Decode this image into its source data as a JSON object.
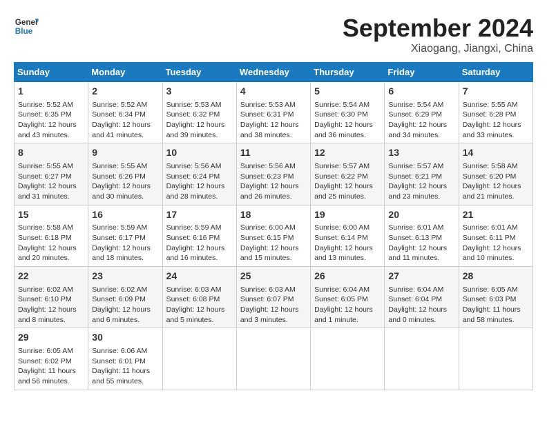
{
  "logo": {
    "line1": "General",
    "line2": "Blue"
  },
  "title": "September 2024",
  "subtitle": "Xiaogang, Jiangxi, China",
  "weekdays": [
    "Sunday",
    "Monday",
    "Tuesday",
    "Wednesday",
    "Thursday",
    "Friday",
    "Saturday"
  ],
  "weeks": [
    [
      {
        "day": "1",
        "info": "Sunrise: 5:52 AM\nSunset: 6:35 PM\nDaylight: 12 hours\nand 43 minutes."
      },
      {
        "day": "2",
        "info": "Sunrise: 5:52 AM\nSunset: 6:34 PM\nDaylight: 12 hours\nand 41 minutes."
      },
      {
        "day": "3",
        "info": "Sunrise: 5:53 AM\nSunset: 6:32 PM\nDaylight: 12 hours\nand 39 minutes."
      },
      {
        "day": "4",
        "info": "Sunrise: 5:53 AM\nSunset: 6:31 PM\nDaylight: 12 hours\nand 38 minutes."
      },
      {
        "day": "5",
        "info": "Sunrise: 5:54 AM\nSunset: 6:30 PM\nDaylight: 12 hours\nand 36 minutes."
      },
      {
        "day": "6",
        "info": "Sunrise: 5:54 AM\nSunset: 6:29 PM\nDaylight: 12 hours\nand 34 minutes."
      },
      {
        "day": "7",
        "info": "Sunrise: 5:55 AM\nSunset: 6:28 PM\nDaylight: 12 hours\nand 33 minutes."
      }
    ],
    [
      {
        "day": "8",
        "info": "Sunrise: 5:55 AM\nSunset: 6:27 PM\nDaylight: 12 hours\nand 31 minutes."
      },
      {
        "day": "9",
        "info": "Sunrise: 5:55 AM\nSunset: 6:26 PM\nDaylight: 12 hours\nand 30 minutes."
      },
      {
        "day": "10",
        "info": "Sunrise: 5:56 AM\nSunset: 6:24 PM\nDaylight: 12 hours\nand 28 minutes."
      },
      {
        "day": "11",
        "info": "Sunrise: 5:56 AM\nSunset: 6:23 PM\nDaylight: 12 hours\nand 26 minutes."
      },
      {
        "day": "12",
        "info": "Sunrise: 5:57 AM\nSunset: 6:22 PM\nDaylight: 12 hours\nand 25 minutes."
      },
      {
        "day": "13",
        "info": "Sunrise: 5:57 AM\nSunset: 6:21 PM\nDaylight: 12 hours\nand 23 minutes."
      },
      {
        "day": "14",
        "info": "Sunrise: 5:58 AM\nSunset: 6:20 PM\nDaylight: 12 hours\nand 21 minutes."
      }
    ],
    [
      {
        "day": "15",
        "info": "Sunrise: 5:58 AM\nSunset: 6:18 PM\nDaylight: 12 hours\nand 20 minutes."
      },
      {
        "day": "16",
        "info": "Sunrise: 5:59 AM\nSunset: 6:17 PM\nDaylight: 12 hours\nand 18 minutes."
      },
      {
        "day": "17",
        "info": "Sunrise: 5:59 AM\nSunset: 6:16 PM\nDaylight: 12 hours\nand 16 minutes."
      },
      {
        "day": "18",
        "info": "Sunrise: 6:00 AM\nSunset: 6:15 PM\nDaylight: 12 hours\nand 15 minutes."
      },
      {
        "day": "19",
        "info": "Sunrise: 6:00 AM\nSunset: 6:14 PM\nDaylight: 12 hours\nand 13 minutes."
      },
      {
        "day": "20",
        "info": "Sunrise: 6:01 AM\nSunset: 6:13 PM\nDaylight: 12 hours\nand 11 minutes."
      },
      {
        "day": "21",
        "info": "Sunrise: 6:01 AM\nSunset: 6:11 PM\nDaylight: 12 hours\nand 10 minutes."
      }
    ],
    [
      {
        "day": "22",
        "info": "Sunrise: 6:02 AM\nSunset: 6:10 PM\nDaylight: 12 hours\nand 8 minutes."
      },
      {
        "day": "23",
        "info": "Sunrise: 6:02 AM\nSunset: 6:09 PM\nDaylight: 12 hours\nand 6 minutes."
      },
      {
        "day": "24",
        "info": "Sunrise: 6:03 AM\nSunset: 6:08 PM\nDaylight: 12 hours\nand 5 minutes."
      },
      {
        "day": "25",
        "info": "Sunrise: 6:03 AM\nSunset: 6:07 PM\nDaylight: 12 hours\nand 3 minutes."
      },
      {
        "day": "26",
        "info": "Sunrise: 6:04 AM\nSunset: 6:05 PM\nDaylight: 12 hours\nand 1 minute."
      },
      {
        "day": "27",
        "info": "Sunrise: 6:04 AM\nSunset: 6:04 PM\nDaylight: 12 hours\nand 0 minutes."
      },
      {
        "day": "28",
        "info": "Sunrise: 6:05 AM\nSunset: 6:03 PM\nDaylight: 11 hours\nand 58 minutes."
      }
    ],
    [
      {
        "day": "29",
        "info": "Sunrise: 6:05 AM\nSunset: 6:02 PM\nDaylight: 11 hours\nand 56 minutes."
      },
      {
        "day": "30",
        "info": "Sunrise: 6:06 AM\nSunset: 6:01 PM\nDaylight: 11 hours\nand 55 minutes."
      },
      null,
      null,
      null,
      null,
      null
    ]
  ]
}
